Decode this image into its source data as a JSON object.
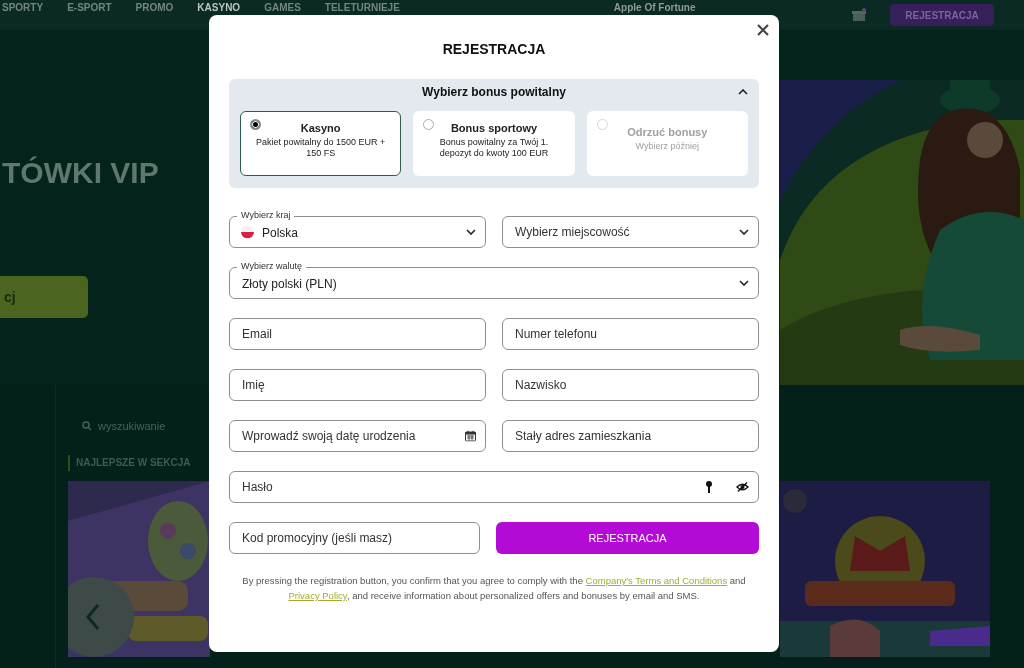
{
  "site_header": {
    "nav": [
      {
        "label": "SPORTY",
        "selected": false
      },
      {
        "label": "E-SPORT",
        "selected": false
      },
      {
        "label": "PROMO",
        "selected": false
      },
      {
        "label": "KASYNO",
        "selected": true
      },
      {
        "label": "GAMES",
        "selected": false
      },
      {
        "label": "TELETURNIEJE",
        "selected": false
      }
    ],
    "featured_game": "Apple Of Fortune",
    "register_button": "REJESTRACJA"
  },
  "hero": {
    "title": "TÓWKI VIP",
    "button": "cj"
  },
  "games_section": {
    "search": {
      "placeholder": "wyszukiwanie"
    },
    "heading": "NAJLEPSZE W SEKCJA"
  },
  "dialog": {
    "title": "REJESTRACJA",
    "bonus": {
      "title": "Wybierz bonus powitalny",
      "expanded": true,
      "options": [
        {
          "title": "Kasyno",
          "description": "Pakiet powitalny do 1500 EUR + 150 FS",
          "selected": true,
          "disabled": false
        },
        {
          "title": "Bonus sportowy",
          "description": "Bonus powitalny za Twój 1. depozyt do kwoty 100 EUR",
          "selected": false,
          "disabled": false
        },
        {
          "title": "Odrzuć bonusy",
          "description": "Wybierz później",
          "selected": false,
          "disabled": true
        }
      ]
    },
    "rows": [
      [
        {
          "kind": "country",
          "label": "Wybierz kraj",
          "value": "Polska"
        },
        {
          "kind": "select",
          "placeholder": "Wybierz miejscowość"
        }
      ],
      [
        {
          "kind": "select",
          "label": "Wybierz walutę",
          "value": "Złoty polski (PLN)"
        }
      ],
      [
        {
          "kind": "text",
          "placeholder": "Email"
        },
        {
          "kind": "text",
          "placeholder": "Numer telefonu"
        }
      ],
      [
        {
          "kind": "text",
          "placeholder": "Imię"
        },
        {
          "kind": "text",
          "placeholder": "Nazwisko"
        }
      ],
      [
        {
          "kind": "date",
          "placeholder": "Wprowadź swoją datę urodzenia"
        },
        {
          "kind": "text",
          "placeholder": "Stały adres zamieszkania"
        }
      ],
      [
        {
          "kind": "password",
          "placeholder": "Hasło"
        }
      ],
      [
        {
          "kind": "text",
          "placeholder": "Kod promocyjny (jeśli masz)"
        },
        {
          "kind": "submit",
          "label": "REJESTRACJA"
        }
      ]
    ],
    "consent": [
      {
        "kind": "text",
        "text": "By pressing the registration button, you confirm that you agree to comply with the "
      },
      {
        "kind": "link",
        "text": "Company's Terms and Conditions"
      },
      {
        "kind": "text",
        "text": " and "
      },
      {
        "kind": "link",
        "text": "Privacy Policy"
      },
      {
        "kind": "text",
        "text": ", and receive information about personalized offers and bonuses by email and SMS."
      }
    ]
  }
}
